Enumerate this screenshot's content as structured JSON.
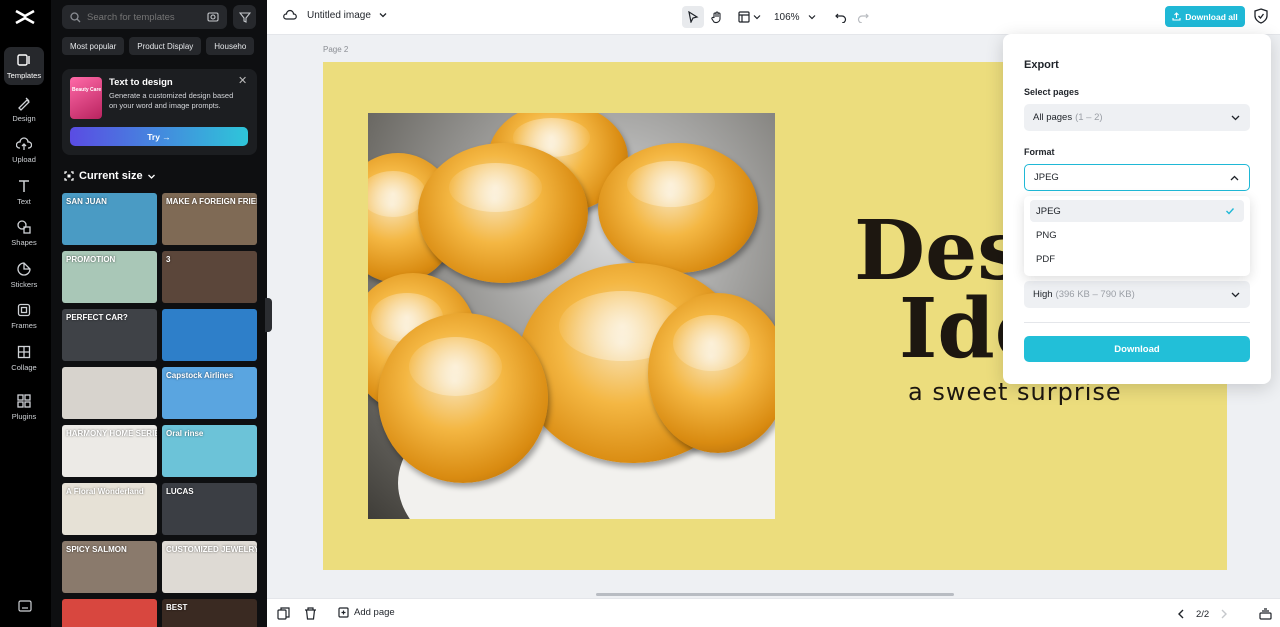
{
  "rail": {
    "items": [
      {
        "label": "Templates"
      },
      {
        "label": "Design"
      },
      {
        "label": "Upload"
      },
      {
        "label": "Text"
      },
      {
        "label": "Shapes"
      },
      {
        "label": "Stickers"
      },
      {
        "label": "Frames"
      },
      {
        "label": "Collage"
      },
      {
        "label": "Plugins"
      }
    ]
  },
  "panel": {
    "search_placeholder": "Search for templates",
    "chips": [
      "Most popular",
      "Product Display",
      "Househo"
    ],
    "promo": {
      "title": "Text to design",
      "desc": "Generate a customized design based on your word and image prompts.",
      "thumb_text": "Beauty Care",
      "try_label": "Try →"
    },
    "current_size_label": "Current size",
    "templates": [
      {
        "text": "SAN JUAN",
        "color": "#4a9bc4"
      },
      {
        "text": "MAKE A FOREIGN FRIEND?",
        "color": "#7f6a55"
      },
      {
        "text": "PROMOTION",
        "color": "#a9c7b7"
      },
      {
        "text": "3",
        "color": "#5b463a"
      },
      {
        "text": "PERFECT CAR?",
        "color": "#3f4247"
      },
      {
        "text": "",
        "color": "#2e7fc9"
      },
      {
        "text": "",
        "color": "#d7d3cd"
      },
      {
        "text": "Capstock Airlines",
        "color": "#5aa5e0"
      },
      {
        "text": "HARMONY HOME SERIES",
        "color": "#eceae6"
      },
      {
        "text": "Oral rinse",
        "color": "#6cc3d8"
      },
      {
        "text": "A Floral Wonderland",
        "color": "#e6e1d6"
      },
      {
        "text": "LUCAS",
        "color": "#3b3e44"
      },
      {
        "text": "SPICY SALMON",
        "color": "#8a7a6c"
      },
      {
        "text": "CUSTOMIZED JEWELRY",
        "color": "#dedad4"
      },
      {
        "text": "",
        "color": "#d8473f"
      },
      {
        "text": "BEST",
        "color": "#3a2a22"
      }
    ]
  },
  "topbar": {
    "doc_title": "Untitled image",
    "zoom": "106%",
    "download_all": "Download all"
  },
  "canvas": {
    "page_label": "Page 2",
    "headline_line1": "Dess",
    "headline_line2": "Idea",
    "subtitle": "a sweet surprise",
    "bg_color": "#ecdd7d"
  },
  "bottombar": {
    "add_page": "Add page",
    "page_counter": "2/2"
  },
  "export": {
    "title": "Export",
    "select_pages_label": "Select pages",
    "pages_value": "All pages",
    "pages_range": "(1 – 2)",
    "format_label": "Format",
    "format_value": "JPEG",
    "format_options": [
      "JPEG",
      "PNG",
      "PDF"
    ],
    "quality_value": "High",
    "quality_range": "(396 KB – 790 KB)",
    "download_label": "Download"
  }
}
